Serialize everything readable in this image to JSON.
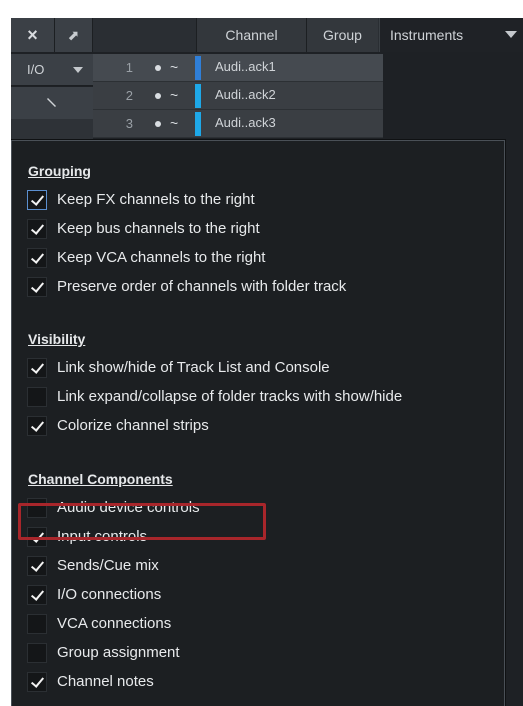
{
  "header": {
    "close_icon": "×",
    "arrow_icon": "⬈",
    "col_channel": "Channel",
    "col_group": "Group",
    "instruments": "Instruments"
  },
  "left": {
    "io_label": "I/O",
    "wrench_icon": "🔧"
  },
  "tracks": [
    {
      "num": "1",
      "name": "Audi..ack1",
      "color": "#2f7fd8"
    },
    {
      "num": "2",
      "name": "Audi..ack2",
      "color": "#1ea8e8"
    },
    {
      "num": "3",
      "name": "Audi..ack3",
      "color": "#1ea8e8"
    }
  ],
  "menu": {
    "sections": [
      {
        "title": "Grouping",
        "items": [
          {
            "label": "Keep FX channels to the right",
            "checked": true,
            "focus": true
          },
          {
            "label": "Keep bus channels to the right",
            "checked": true
          },
          {
            "label": "Keep VCA channels to the right",
            "checked": true
          },
          {
            "label": "Preserve order of channels with folder track",
            "checked": true
          }
        ]
      },
      {
        "title": "Visibility",
        "items": [
          {
            "label": "Link show/hide of Track List and Console",
            "checked": true
          },
          {
            "label": "Link expand/collapse of folder tracks with show/hide",
            "checked": false
          },
          {
            "label": "Colorize channel strips",
            "checked": true
          }
        ]
      },
      {
        "title": "Channel Components",
        "items": [
          {
            "label": "Audio device controls",
            "checked": false
          },
          {
            "label": "Input controls",
            "checked": true
          },
          {
            "label": "Sends/Cue mix",
            "checked": true
          },
          {
            "label": "I/O connections",
            "checked": true
          },
          {
            "label": "VCA connections",
            "checked": false
          },
          {
            "label": "Group assignment",
            "checked": false
          },
          {
            "label": "Channel notes",
            "checked": true
          }
        ]
      }
    ]
  },
  "colors": {
    "highlight": "#a8262b",
    "menu_bg": "#1c1f22",
    "panel_bg": "#1e2125"
  }
}
